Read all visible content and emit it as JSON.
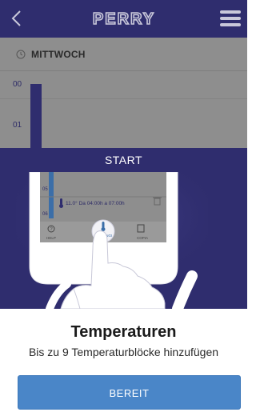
{
  "header": {
    "logo_text": "PERRY",
    "back_icon": "chevron-left-icon",
    "menu_icon": "hamburger-menu-icon"
  },
  "background": {
    "day_label": "MITTWOCH",
    "hours": [
      "00",
      "01"
    ]
  },
  "tutorial": {
    "title": "START",
    "phone_hours": [
      "05",
      "06"
    ],
    "phone_temp_entry": "11.0° Da 04:00h a 07:00h",
    "phone_nav": [
      "HELP",
      "AGGIUNGI",
      "COPIA"
    ]
  },
  "card": {
    "title": "Temperaturen",
    "subtitle": "Bis zu 9 Temperaturblöcke hinzufügen",
    "button_label": "BEREIT"
  },
  "colors": {
    "navy": "#2f2d6e",
    "button_blue": "#4a86c8"
  }
}
